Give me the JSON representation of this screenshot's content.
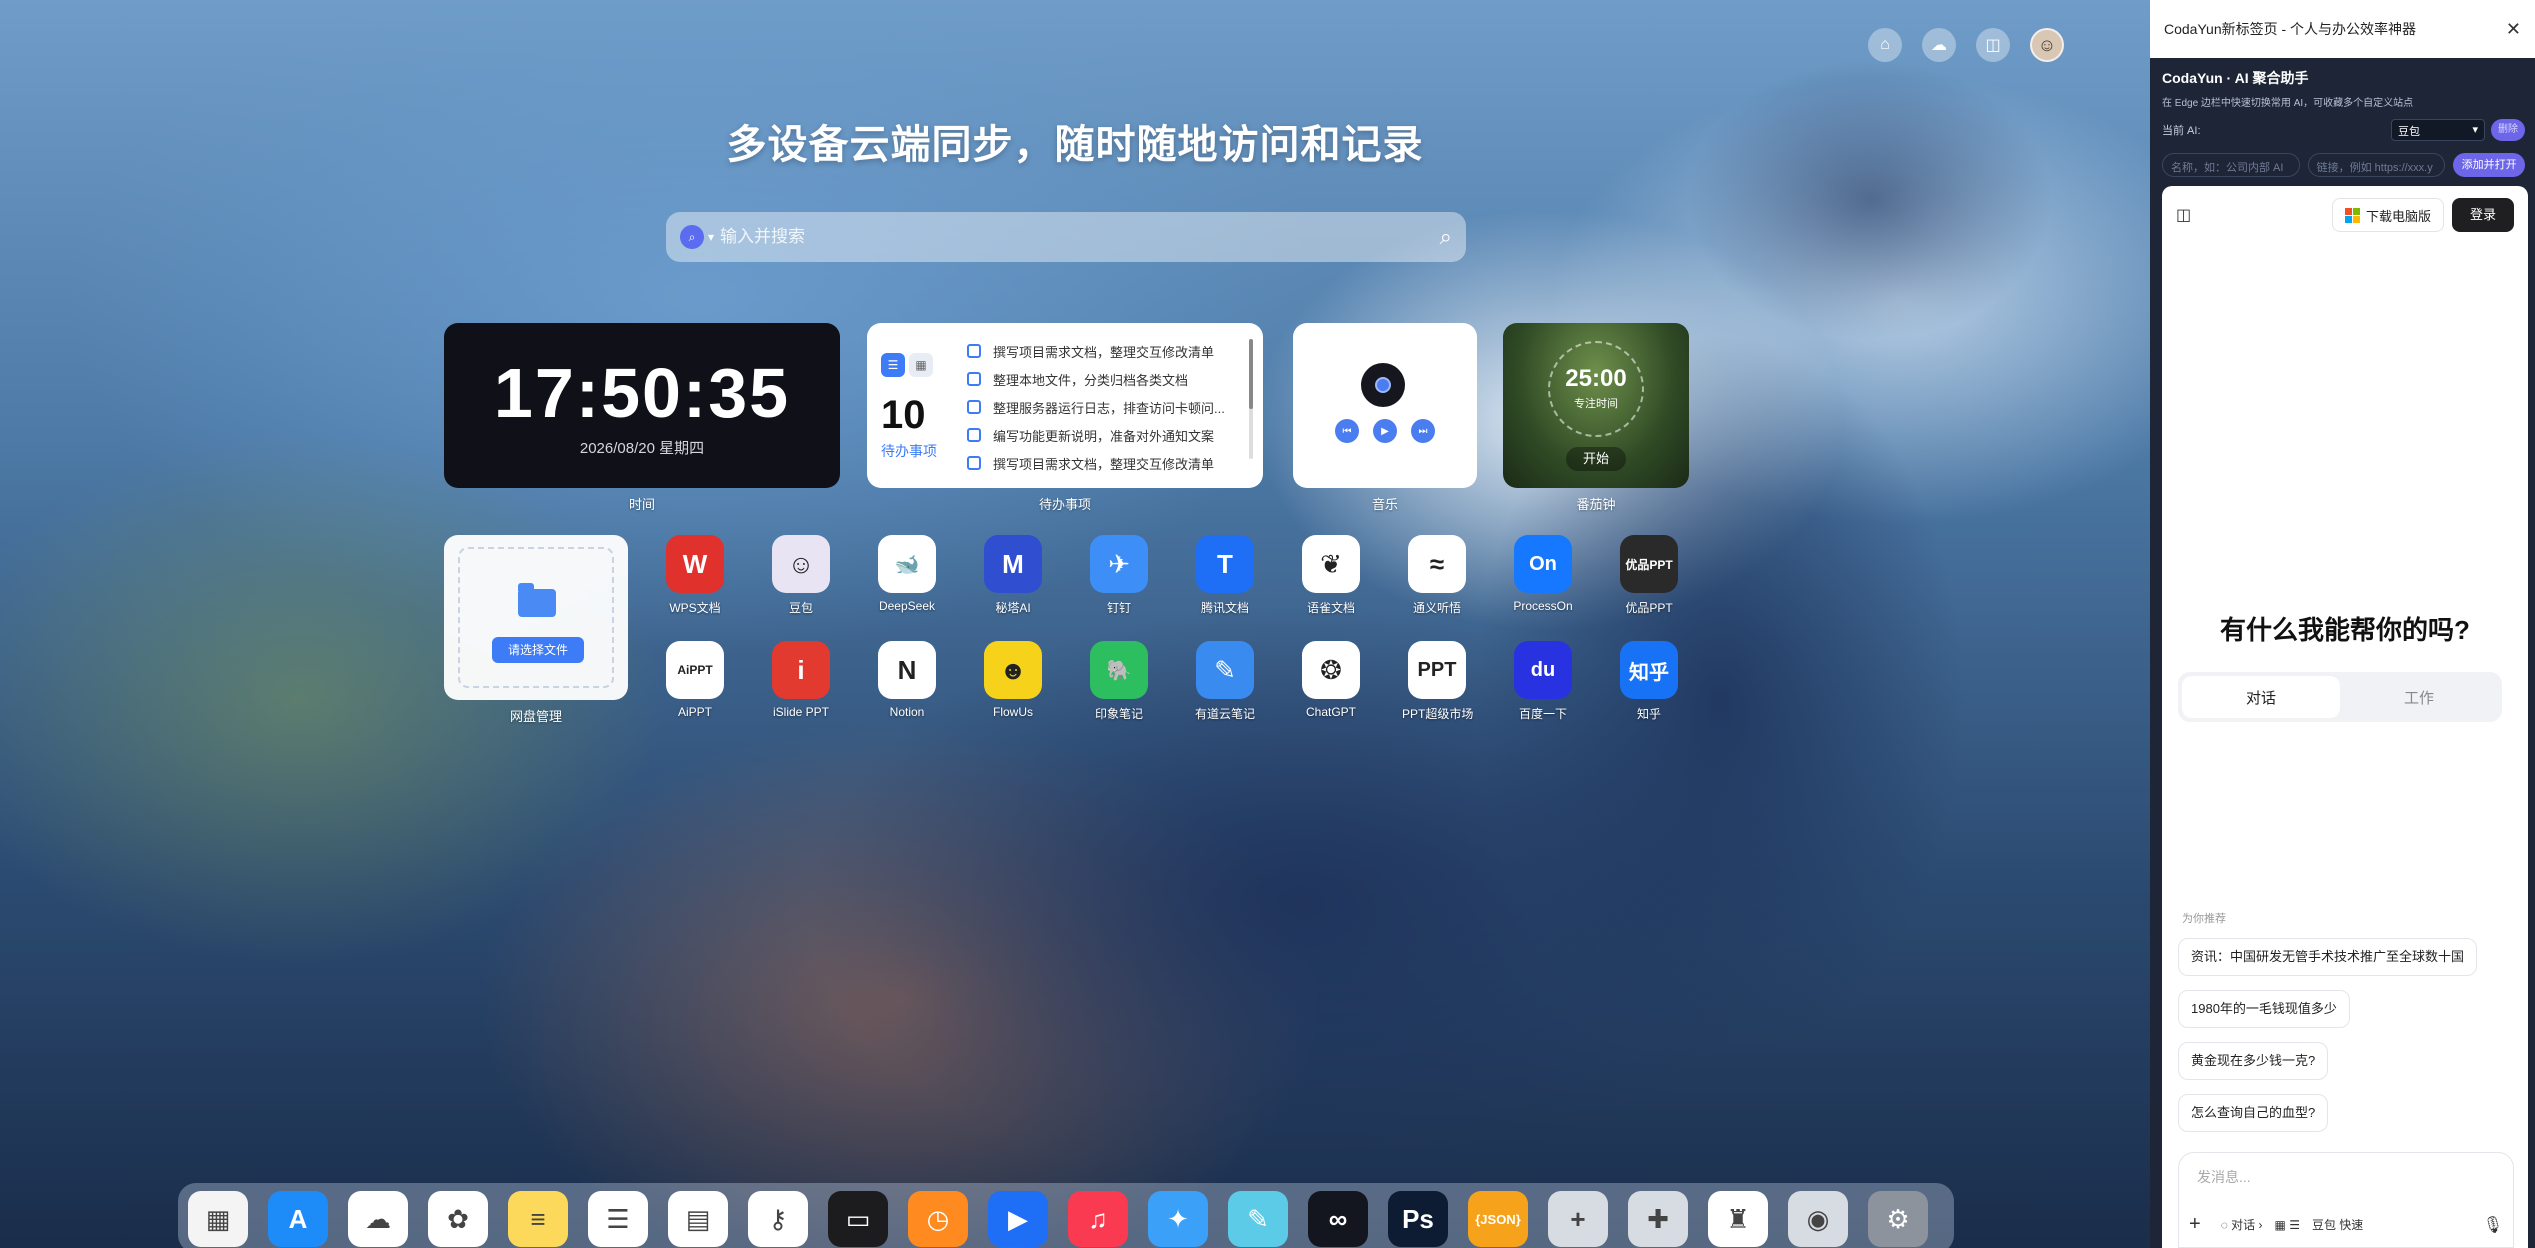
{
  "main": {
    "headline": "多设备云端同步，随时随地访问和记录",
    "search": {
      "placeholder": "输入并搜索"
    },
    "clock": {
      "time": "17:50:35",
      "date": "2026/08/20 星期四",
      "label": "时间"
    },
    "todo": {
      "count": "10",
      "count_label": "待办事项",
      "label": "待办事项",
      "items": [
        "撰写项目需求文档，整理交互修改清单",
        "整理本地文件，分类归档各类文档",
        "整理服务器运行日志，排查访问卡顿问...",
        "编写功能更新说明，准备对外通知文案",
        "撰写项目需求文档，整理交互修改清单"
      ]
    },
    "music": {
      "label": "音乐"
    },
    "pomodoro": {
      "time": "25:00",
      "sub": "专注时间",
      "start": "开始",
      "label": "番茄钟"
    },
    "disk": {
      "button": "请选择文件",
      "label": "网盘管理"
    },
    "apps_row1": [
      {
        "name": "WPS文档",
        "glyph": "W",
        "color": "#e0312c"
      },
      {
        "name": "豆包",
        "glyph": "☺",
        "color": "#e9e4f3"
      },
      {
        "name": "DeepSeek",
        "glyph": "🐋",
        "color": "#ffffff"
      },
      {
        "name": "秘塔AI",
        "glyph": "M",
        "color": "#2f4fd0"
      },
      {
        "name": "钉钉",
        "glyph": "✈",
        "color": "#3e8ef7"
      },
      {
        "name": "腾讯文档",
        "glyph": "T",
        "color": "#1e6ff5"
      },
      {
        "name": "语雀文档",
        "glyph": "❦",
        "color": "#ffffff"
      },
      {
        "name": "通义听悟",
        "glyph": "≈",
        "color": "#ffffff"
      },
      {
        "name": "ProcessOn",
        "glyph": "On",
        "color": "#1677ff"
      },
      {
        "name": "优品PPT",
        "glyph": "优品PPT",
        "color": "#2a2a2a"
      }
    ],
    "apps_row2": [
      {
        "name": "AiPPT",
        "glyph": "AiPPT",
        "color": "#ffffff"
      },
      {
        "name": "iSlide PPT",
        "glyph": "i",
        "color": "#e23a2e"
      },
      {
        "name": "Notion",
        "glyph": "N",
        "color": "#ffffff"
      },
      {
        "name": "FlowUs",
        "glyph": "☻",
        "color": "#f7d21a"
      },
      {
        "name": "印象笔记",
        "glyph": "🐘",
        "color": "#2dbe60"
      },
      {
        "name": "有道云笔记",
        "glyph": "✎",
        "color": "#3a8bf0"
      },
      {
        "name": "ChatGPT",
        "glyph": "❂",
        "color": "#ffffff"
      },
      {
        "name": "PPT超级市场",
        "glyph": "PPT",
        "color": "#ffffff"
      },
      {
        "name": "百度一下",
        "glyph": "du",
        "color": "#2932e1"
      },
      {
        "name": "知乎",
        "glyph": "知乎",
        "color": "#1772f6"
      }
    ],
    "dock": [
      {
        "name": "launchpad-icon",
        "glyph": "▦",
        "color": "#f4f4f4"
      },
      {
        "name": "app-store-icon",
        "glyph": "A",
        "color": "#1d8cf8"
      },
      {
        "name": "icloud-icon",
        "glyph": "☁",
        "color": "#ffffff"
      },
      {
        "name": "photos-icon",
        "glyph": "✿",
        "color": "#ffffff"
      },
      {
        "name": "notes-icon",
        "glyph": "≡",
        "color": "#fcd95a"
      },
      {
        "name": "reminders-icon",
        "glyph": "☰",
        "color": "#ffffff"
      },
      {
        "name": "calendar-icon",
        "glyph": "▤",
        "color": "#ffffff"
      },
      {
        "name": "passwords-icon",
        "glyph": "⚷",
        "color": "#ffffff"
      },
      {
        "name": "wallet-icon",
        "glyph": "▭",
        "color": "#1c1c1e"
      },
      {
        "name": "clock-icon",
        "glyph": "◷",
        "color": "#ff8a1f"
      },
      {
        "name": "play-icon",
        "glyph": "▶",
        "color": "#1e6ff5"
      },
      {
        "name": "music-icon",
        "glyph": "♫",
        "color": "#fa3a50"
      },
      {
        "name": "safari-icon",
        "glyph": "✦",
        "color": "#3aa0f8"
      },
      {
        "name": "pencil-icon",
        "glyph": "✎",
        "color": "#5ccbe8"
      },
      {
        "name": "infinity-icon",
        "glyph": "∞",
        "color": "#14161f"
      },
      {
        "name": "photoshop-icon",
        "glyph": "Ps",
        "color": "#0d1c33"
      },
      {
        "name": "json-icon",
        "glyph": "{JSON}",
        "color": "#f7a21b"
      },
      {
        "name": "add-icon",
        "glyph": "+",
        "color": "#d7dbe2"
      },
      {
        "name": "puzzle-icon",
        "glyph": "✚",
        "color": "#d7dbe2"
      },
      {
        "name": "brush-icon",
        "glyph": "♜",
        "color": "#ffffff"
      },
      {
        "name": "settings-dial-icon",
        "glyph": "◉",
        "color": "#d7dbe2"
      },
      {
        "name": "system-settings-icon",
        "glyph": "⚙",
        "color": "#8d939c"
      }
    ]
  },
  "side": {
    "title": "CodaYun新标签页 - 个人与办公效率神器",
    "panel_heading": "CodaYun · AI 聚合助手",
    "panel_sub": "在 Edge 边栏中快速切换常用 AI，可收藏多个自定义站点",
    "current_ai_label": "当前 AI:",
    "current_ai_value": "豆包",
    "delete_label": "删除",
    "name_placeholder": "名称，如：公司内部 AI",
    "url_placeholder": "链接，例如 https://xxx.y",
    "add_open": "添加并打开",
    "download": "下载电脑版",
    "login": "登录",
    "hello": "有什么我能帮你的吗?",
    "tabs": [
      "对话",
      "工作"
    ],
    "recommend_label": "为你推荐",
    "suggestions": [
      "资讯：中国研发无管手术技术推广至全球数十国",
      "1980年的一毛钱现值多少",
      "黄金现在多少钱一克?",
      "怎么查询自己的血型?"
    ],
    "message_placeholder": "发消息...",
    "tool_chat": "对话",
    "tool_more": "豆包 快速"
  }
}
